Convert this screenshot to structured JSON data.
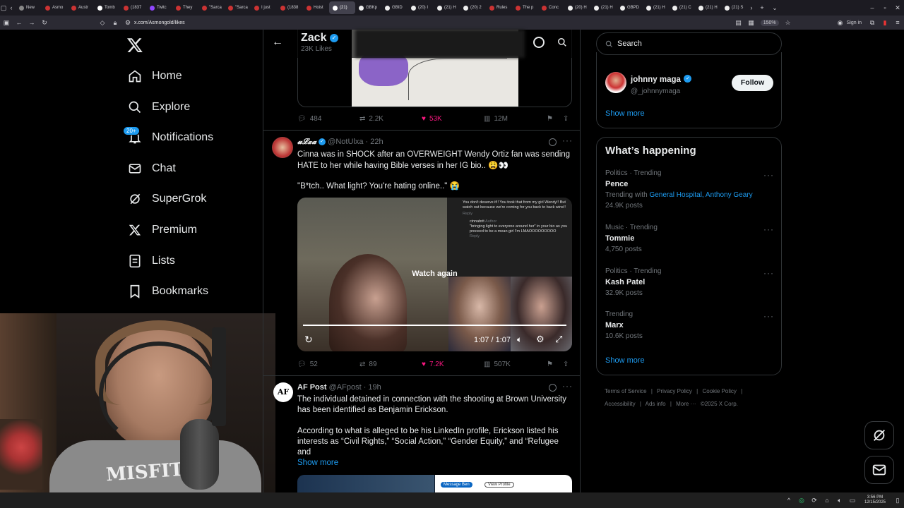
{
  "browser": {
    "tabs": [
      "New",
      "Asmo",
      "Austr",
      "Tomb",
      "(1837",
      "Twitc",
      "They",
      "\"Sarca",
      "\"Sarca",
      "I just",
      "(1838",
      "Hoist",
      "(21)",
      "GBKp",
      "GBID",
      "(20) I",
      "(21) H",
      "(20) 2",
      "Rules",
      "The p",
      "Conc",
      "(20) H",
      "(21) H",
      "GBPD",
      "(21) H",
      "(21) C",
      "(21) H",
      "(21) S"
    ],
    "active_tab": 12,
    "url": "x.com/Asmongold/likes",
    "zoom": "150%",
    "sign_in": "Sign in"
  },
  "nav": {
    "items": [
      "Home",
      "Explore",
      "Notifications",
      "Chat",
      "SuperGrok",
      "Premium",
      "Lists",
      "Bookmarks"
    ],
    "notif_badge": "20+"
  },
  "header": {
    "name": "Zack",
    "subtitle": "23K Likes"
  },
  "tweet1": {
    "replies": "484",
    "retweets": "2.2K",
    "likes": "53K",
    "views": "12M"
  },
  "tweet2": {
    "display_name": "𝓾𝓛𝔁𝓪",
    "handle": "@NotUlxa · 22h",
    "text1": "Cinna was in SHOCK after an OVERWEIGHT Wendy Ortiz fan was sending HATE to her while having Bible verses in her IG bio.. 😩👀",
    "text2": "\"B*tch.. What light? You're hating online..\" 😭",
    "video": {
      "overlay": "Watch again",
      "time": "1:07 / 1:07",
      "comment1": "You don't deserve it!! You took that from my girl Wendy!! But watch out because we're coming for you back to back wins!!",
      "reply1": "Reply",
      "author": "cinnabrit",
      "author_tag": "Author",
      "comment2": "\"bringing light to everyone around her\" in your bio as you proceed to be a mean girl I'm LMAOOOOOOOOO",
      "reply2": "Reply"
    },
    "replies": "52",
    "retweets": "89",
    "likes": "7.2K",
    "views": "507K"
  },
  "tweet3": {
    "display_name": "AF Post",
    "handle": "@AFpost · 19h",
    "text1": "The individual detained in connection with the shooting at Brown University has been identified as Benjamin Erickson.",
    "text2": "According to what is alleged to be his LinkedIn profile, Erickson listed his interests as “Civil Rights,” “Social Action,” “Gender Equity,” and “Refugee and",
    "show_more": "Show more",
    "button1": "Message Ben",
    "button2": "View Profile"
  },
  "search": {
    "placeholder": "Search"
  },
  "follow": {
    "name": "johnny maga",
    "handle": "@_johnnymaga",
    "button": "Follow",
    "show_more": "Show more"
  },
  "trends": {
    "title": "What’s happening",
    "items": [
      {
        "meta": "Politics · Trending",
        "name": "Pence",
        "extra_prefix": "Trending with ",
        "extra_links": "General Hospital, Anthony Geary",
        "posts": "24.9K posts"
      },
      {
        "meta": "Music · Trending",
        "name": "Tommie",
        "posts": "4,750 posts"
      },
      {
        "meta": "Politics · Trending",
        "name": "Kash Patel",
        "posts": "32.9K posts"
      },
      {
        "meta": "Trending",
        "name": "Marx",
        "posts": "10.6K posts"
      }
    ],
    "show_more": "Show more"
  },
  "footer": {
    "links": [
      "Terms of Service",
      "|",
      "Privacy Policy",
      "|",
      "Cookie Policy",
      "|",
      "Accessibility",
      "|",
      "Ads info",
      "|",
      "More ···",
      "©",
      "2025 X Corp."
    ]
  },
  "taskbar": {
    "time": "3:56 PM",
    "date": "12/15/2025"
  },
  "webcam": {
    "shirt_text": "MISFITS"
  },
  "colors": {
    "like": "#f91880",
    "accent": "#1d9bf0",
    "bg": "#000000",
    "border": "#2f3336"
  }
}
